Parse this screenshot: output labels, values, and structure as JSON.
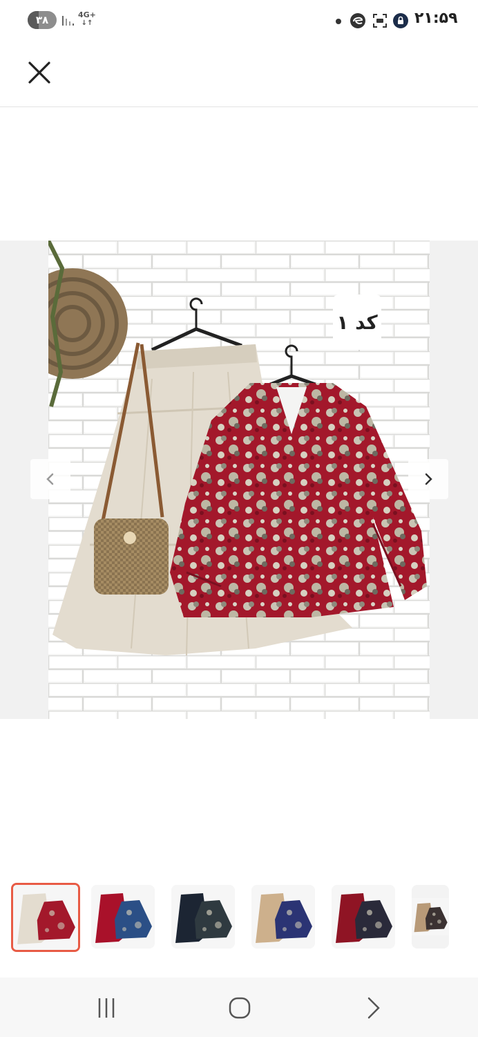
{
  "status_bar": {
    "battery": "۳۸",
    "battery_level": 0.38,
    "network": "4G+",
    "time": "۲۱:۵۹",
    "icons": [
      "dot-icon",
      "edge-app-icon",
      "screenshot-icon",
      "vpn-lock-icon"
    ]
  },
  "header": {
    "close_icon": "close-icon"
  },
  "gallery": {
    "image_label": "کد ۱",
    "current_index": 1,
    "prev_icon": "chevron-left-icon",
    "next_icon": "chevron-right-icon",
    "thumbnails": [
      {
        "name": "cream-skirt-red-floral-top",
        "top": "#a3182b",
        "skirt": "#e3dccf"
      },
      {
        "name": "red-skirt-blue-floral-top",
        "top": "#2b4f86",
        "skirt": "#a9112a"
      },
      {
        "name": "navy-skirt-dark-floral-top",
        "top": "#2f3a40",
        "skirt": "#1c2533"
      },
      {
        "name": "beige-skirt-navy-floral-top",
        "top": "#2b3474",
        "skirt": "#cdb08c"
      },
      {
        "name": "red-skirt-black-floral-top",
        "top": "#2a2a3a",
        "skirt": "#8f1424"
      },
      {
        "name": "beige-skirt-partial",
        "top": "#3b3232",
        "skirt": "#b89a78"
      }
    ]
  },
  "colors": {
    "accent": "#e85b45",
    "wall": "#ededed",
    "top_red": "#a3182b",
    "skirt_cream": "#e3dccf"
  },
  "nav_bar": {
    "keys": [
      "recents-icon",
      "home-icon",
      "back-icon"
    ]
  }
}
